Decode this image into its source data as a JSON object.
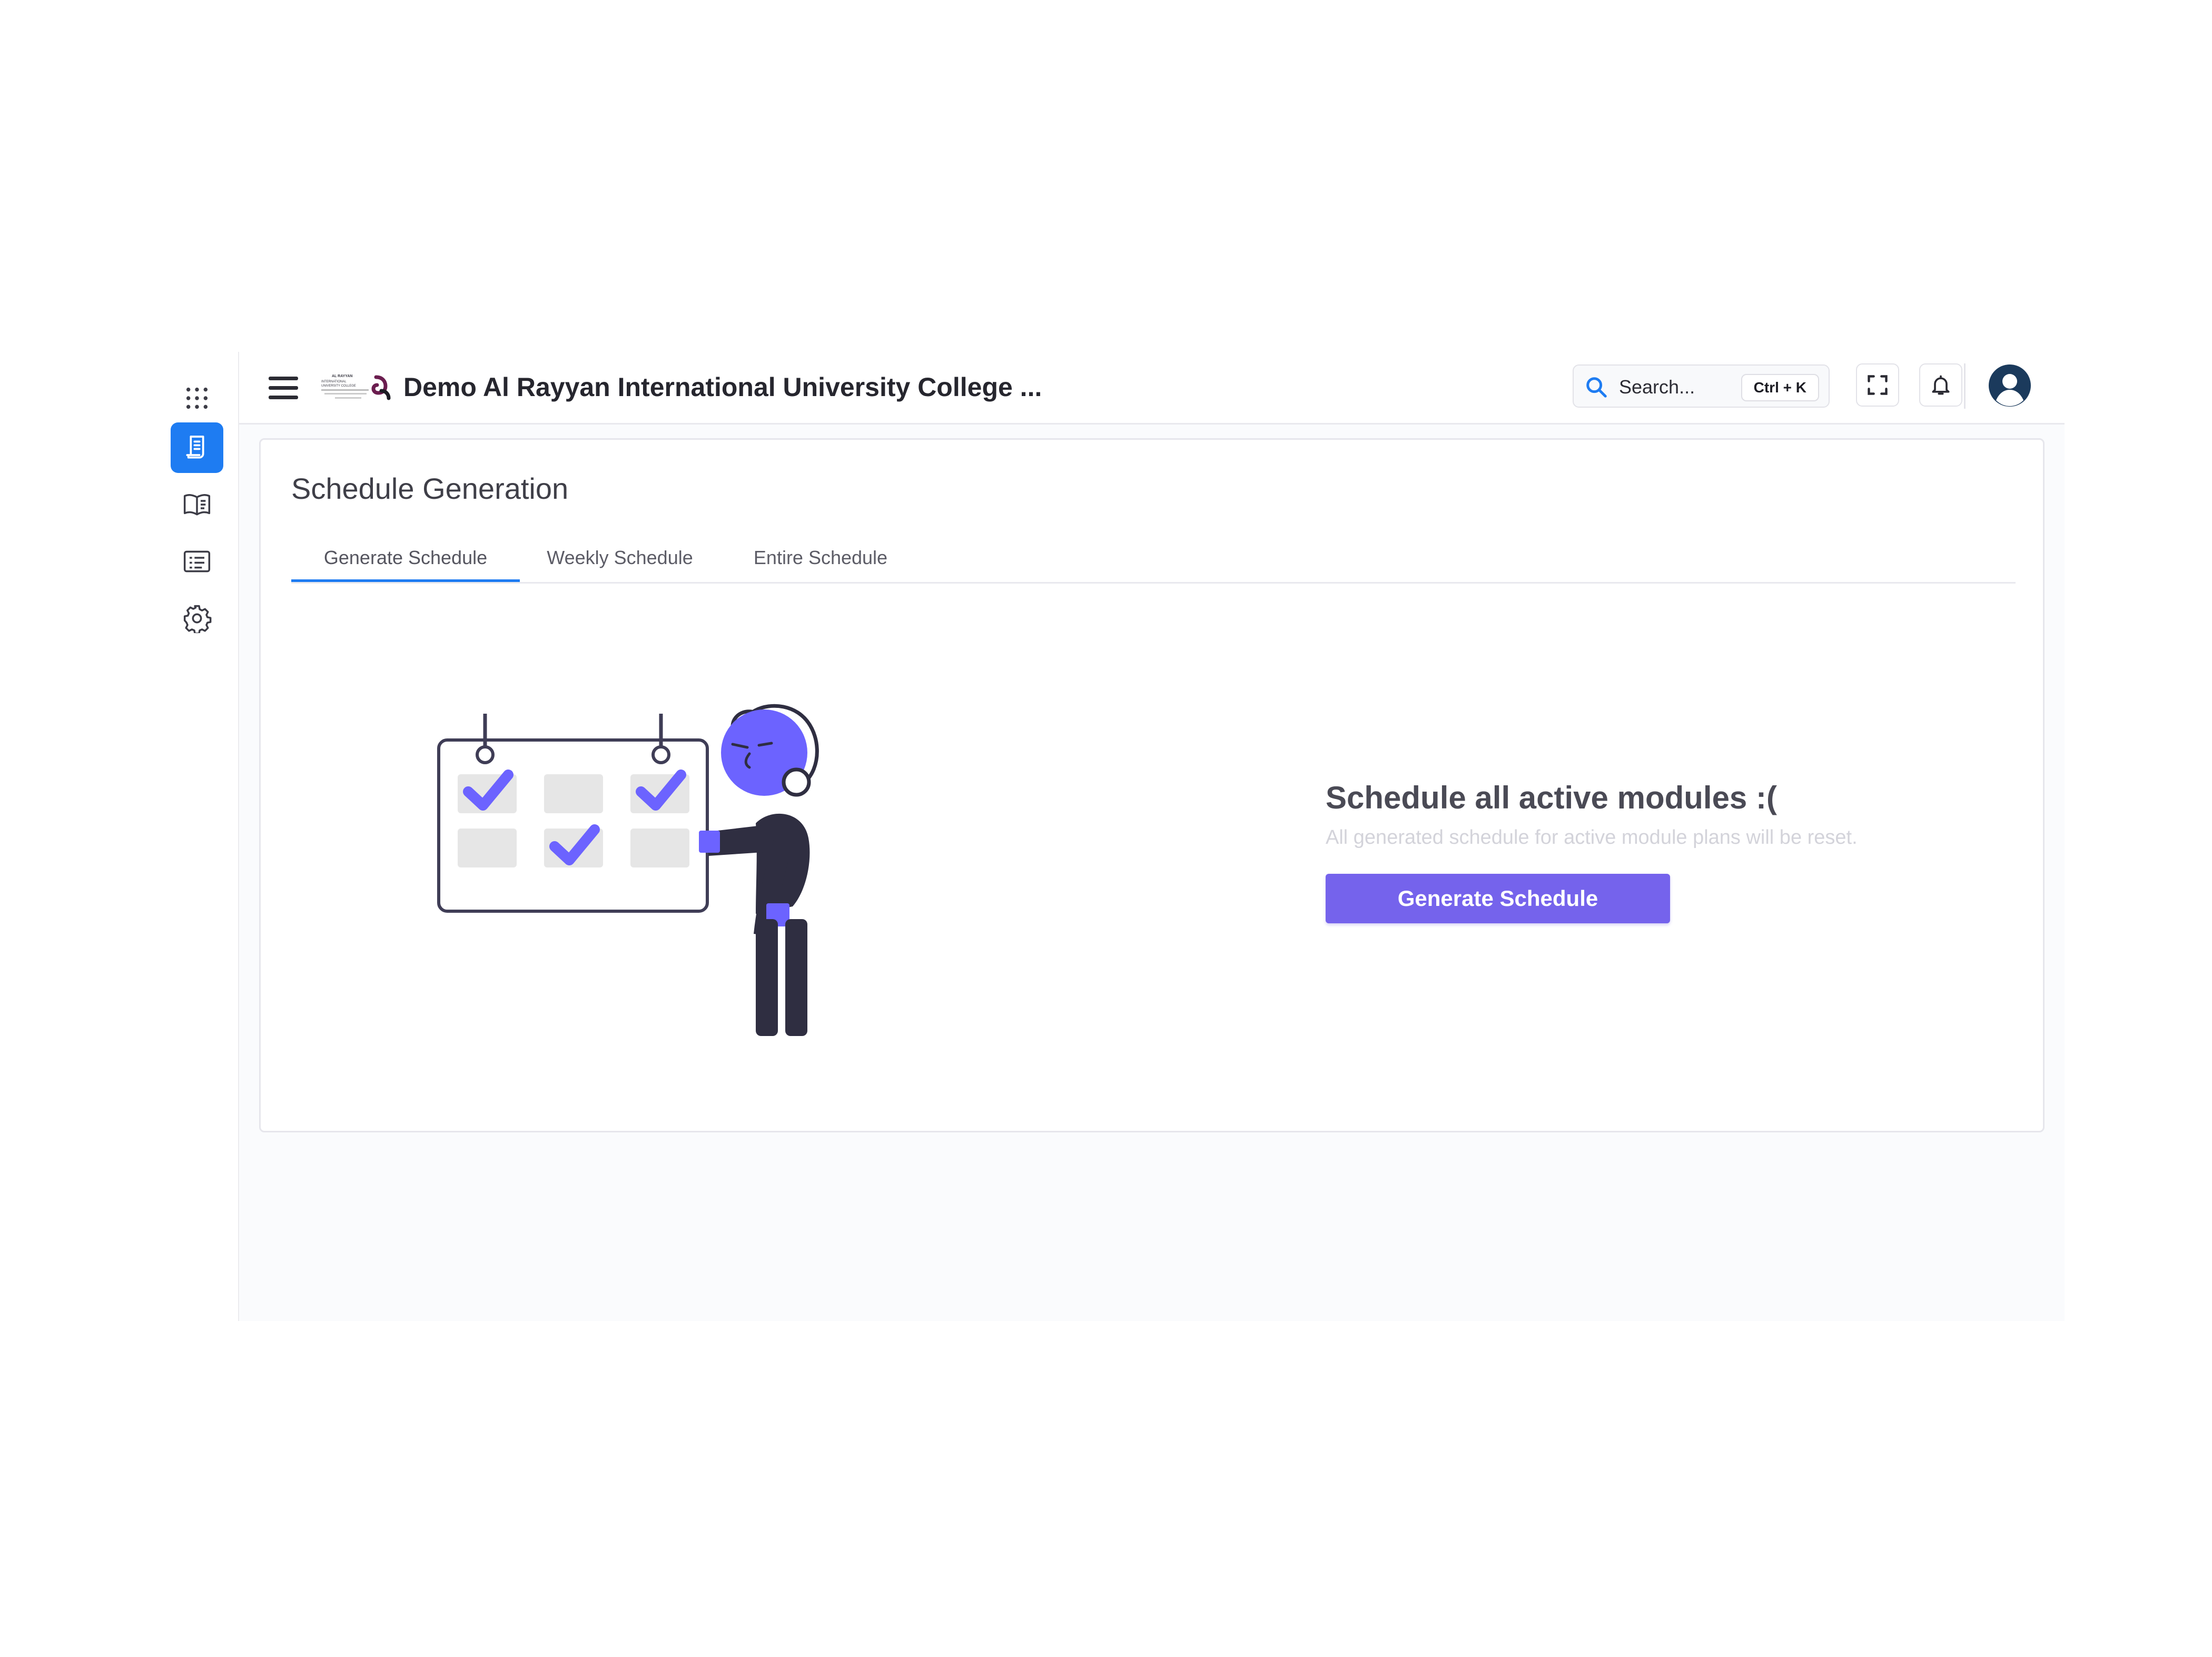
{
  "app": {
    "title": "Demo Al Rayyan International University College ...",
    "logo_text": "AL RAYYAN INTERNATIONAL UNIVERSITY COLLEGE"
  },
  "sidebar": {
    "items": [
      {
        "icon": "apps-grid-icon",
        "active": false
      },
      {
        "icon": "schedule-document-icon",
        "active": true
      },
      {
        "icon": "book-icon",
        "active": false
      },
      {
        "icon": "list-card-icon",
        "active": false
      },
      {
        "icon": "gear-icon",
        "active": false
      }
    ]
  },
  "header": {
    "search": {
      "placeholder": "Search...",
      "shortcut": "Ctrl + K"
    },
    "icons": [
      "fullscreen-icon",
      "bell-icon",
      "user-avatar-icon"
    ]
  },
  "main": {
    "page_title": "Schedule Generation",
    "tabs": [
      {
        "label": "Generate Schedule",
        "active": true
      },
      {
        "label": "Weekly Schedule",
        "active": false
      },
      {
        "label": "Entire Schedule",
        "active": false
      }
    ],
    "cta": {
      "heading": "Schedule all active modules :(",
      "subtext": "All generated schedule for active module plans will be reset.",
      "button_label": "Generate Schedule"
    }
  },
  "colors": {
    "primary_blue": "#1e7cf2",
    "accent_purple": "#7563ec",
    "illustration_purple": "#6c63ff",
    "illustration_dark": "#2f2e41"
  }
}
